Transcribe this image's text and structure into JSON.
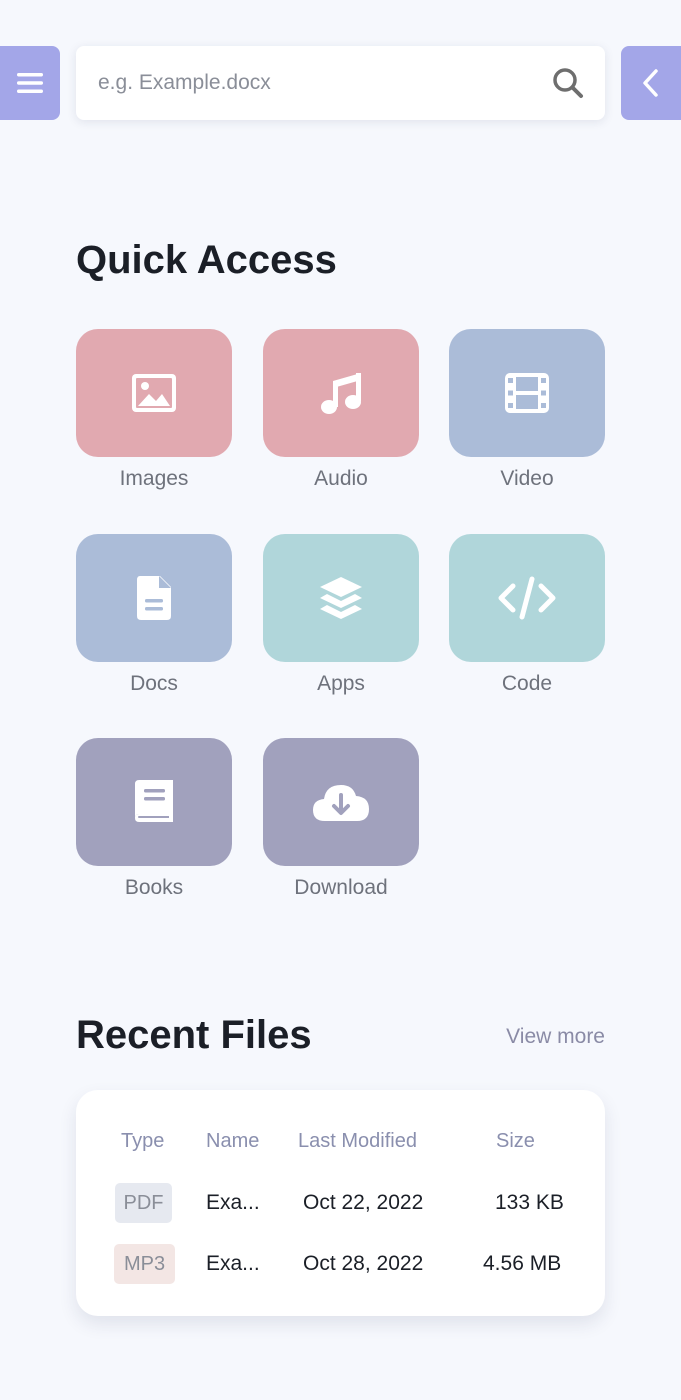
{
  "header": {
    "menu_icon": "hamburger-menu-icon",
    "back_icon": "chevron-left-icon",
    "search": {
      "placeholder": "e.g. Example.docx",
      "value": "",
      "icon": "search-icon"
    }
  },
  "quick_access": {
    "title": "Quick Access",
    "tiles": [
      {
        "label": "Images",
        "icon": "image-icon",
        "color": "#e1a9b0"
      },
      {
        "label": "Audio",
        "icon": "music-note-icon",
        "color": "#e1a9b0"
      },
      {
        "label": "Video",
        "icon": "film-icon",
        "color": "#abbcd8"
      },
      {
        "label": "Docs",
        "icon": "document-icon",
        "color": "#abbcd8"
      },
      {
        "label": "Apps",
        "icon": "layers-icon",
        "color": "#b0d6da"
      },
      {
        "label": "Code",
        "icon": "code-icon",
        "color": "#b0d6da"
      },
      {
        "label": "Books",
        "icon": "book-icon",
        "color": "#a1a1bd"
      },
      {
        "label": "Download",
        "icon": "cloud-download-icon",
        "color": "#a1a1bd"
      }
    ]
  },
  "recent_files": {
    "title": "Recent Files",
    "view_more": "View more",
    "columns": [
      "Type",
      "Name",
      "Last Modified",
      "Size"
    ],
    "rows": [
      {
        "type": "PDF",
        "type_bg": "#e6e9f0",
        "name": "Exa...",
        "modified": "Oct 22, 2022",
        "size": "133 KB"
      },
      {
        "type": "MP3",
        "type_bg": "#f3e6e4",
        "name": "Exa...",
        "modified": "Oct 28, 2022",
        "size": "4.56 MB"
      }
    ]
  }
}
